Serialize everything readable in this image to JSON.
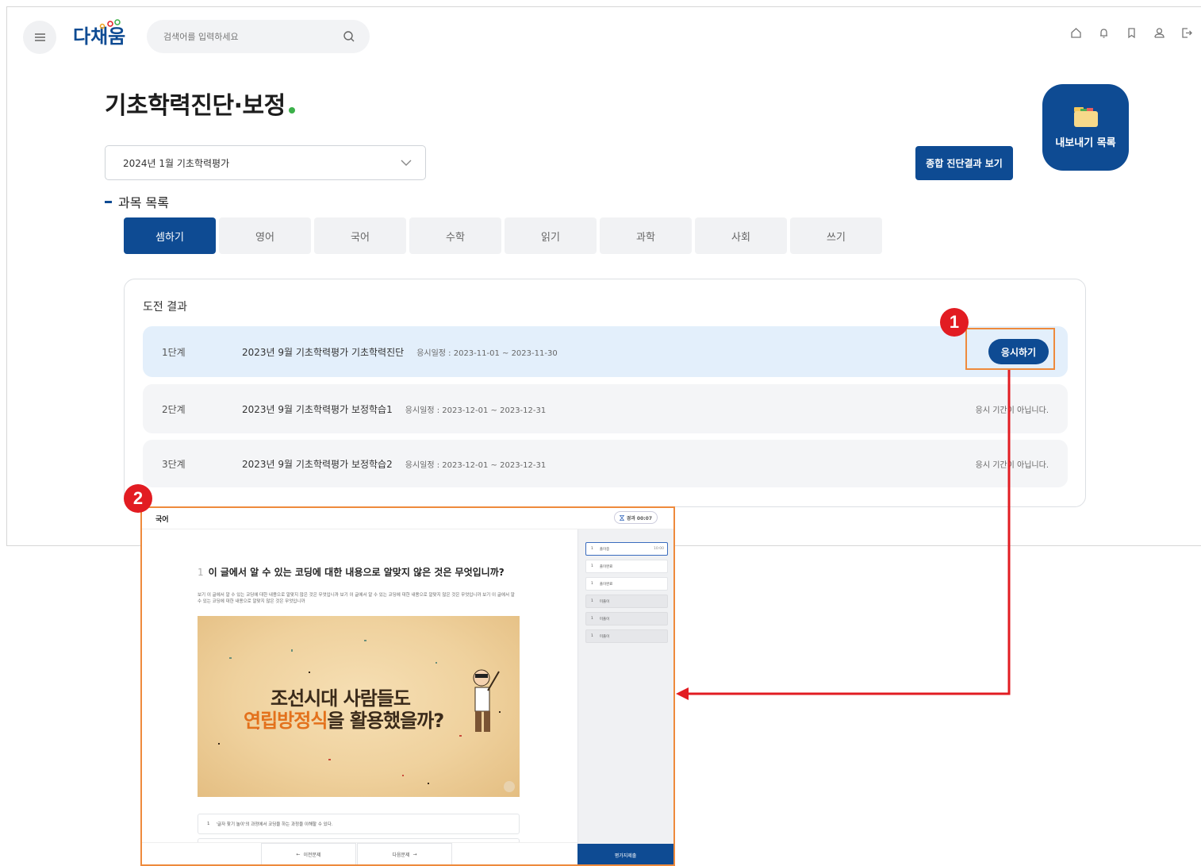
{
  "header": {
    "logo_text": "다채움",
    "search_placeholder": "검색어를 입력하세요",
    "icons": [
      "home-icon",
      "bell-icon",
      "bookmark-icon",
      "user-icon",
      "logout-icon"
    ]
  },
  "page": {
    "title": "기초학력진단·보정",
    "export_label": "내보내기 목록",
    "select_value": "2024년 1월 기초학력평가",
    "summary_button": "종합 진단결과 보기",
    "section_label": "과목 목록"
  },
  "tabs": [
    {
      "label": "셈하기",
      "active": true
    },
    {
      "label": "영어",
      "active": false
    },
    {
      "label": "국어",
      "active": false
    },
    {
      "label": "수학",
      "active": false
    },
    {
      "label": "읽기",
      "active": false
    },
    {
      "label": "과학",
      "active": false
    },
    {
      "label": "사회",
      "active": false
    },
    {
      "label": "쓰기",
      "active": false
    }
  ],
  "results": {
    "title": "도전 결과",
    "rows": [
      {
        "stage": "1단계",
        "name": "2023년 9월 기초학력평가 기초학력진단",
        "date": "응시일정 : 2023-11-01 ~ 2023-11-30",
        "action": "응시하기",
        "status": ""
      },
      {
        "stage": "2단계",
        "name": "2023년 9월 기초학력평가 보정학습1",
        "date": "응시일정 : 2023-12-01 ~ 2023-12-31",
        "action": "",
        "status": "응시 기간이 아닙니다."
      },
      {
        "stage": "3단계",
        "name": "2023년 9월 기초학력평가 보정학습2",
        "date": "응시일정 : 2023-12-01 ~ 2023-12-31",
        "action": "",
        "status": "응시 기간이 아닙니다."
      }
    ]
  },
  "annotations": {
    "badge1": "1",
    "badge2": "2"
  },
  "exam": {
    "subject": "국어",
    "timer": "경과 00:07",
    "question_no": "1",
    "question": "이 글에서 알 수 있는 코딩에 대한 내용으로 알맞지 않은 것은 무엇입니까?",
    "description": "보기 이 글에서 알 수 있는 코딩에 대한 내용으로 알맞지 않은 것은 무엇입니까 보기 이 글에서 알 수 있는 코딩에 대한 내용으로 알맞지 않은 것은 무엇입니까 보기 이 글에서 알 수 있는 코딩에 대한 내용으로 알맞지 않은 것은 무엇입니까",
    "image_line1": "조선시대 사람들도",
    "image_line2_highlight": "연립방정식",
    "image_line2_rest": "을 활용했을까?",
    "choice1_no": "1",
    "choice1": "'글자 찾기 놀이'의 과정에서 코딩을 하는 과정을 이해할 수 있다.",
    "prev_label": "이전문제",
    "next_label": "다음문제",
    "submit_label": "평가지제출",
    "side_items": [
      {
        "no": "1",
        "label": "풀이중",
        "time": "10:00",
        "state": "active"
      },
      {
        "no": "1",
        "label": "풀이완료",
        "time": "",
        "state": "done"
      },
      {
        "no": "1",
        "label": "풀이완료",
        "time": "",
        "state": "done"
      },
      {
        "no": "1",
        "label": "미풀이",
        "time": "",
        "state": "dim"
      },
      {
        "no": "1",
        "label": "미풀이",
        "time": "",
        "state": "dim"
      },
      {
        "no": "1",
        "label": "미풀이",
        "time": "",
        "state": "dim"
      }
    ]
  },
  "colors": {
    "primary": "#0e4b93",
    "highlight_row": "#e3effb",
    "annotation_orange": "#ee8a3c",
    "annotation_red": "#e21c22",
    "title_dot": "#3cb04a"
  }
}
